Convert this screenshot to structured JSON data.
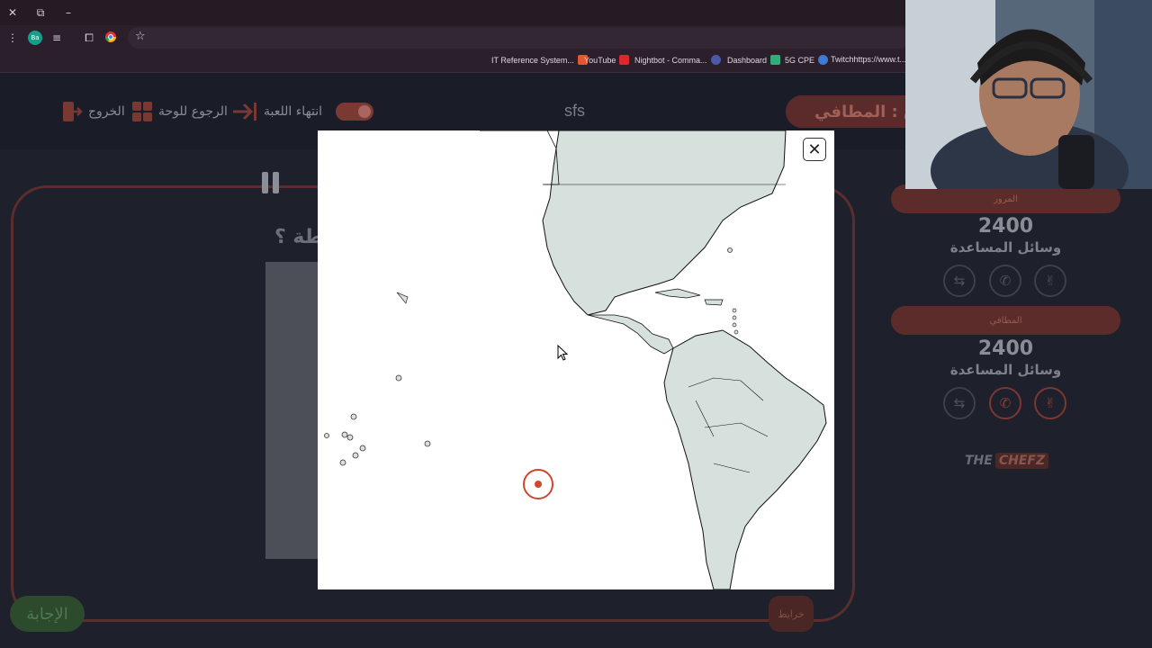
{
  "browser": {
    "bookmarks": [
      {
        "label": "IT Reference System...",
        "color": "#e4572e"
      },
      {
        "label": "YouTube",
        "color": "#e0262d"
      },
      {
        "label": "Nightbot - Comma...",
        "color": "#4a5aa8"
      },
      {
        "label": "Dashboard",
        "color": "#2fae7a"
      },
      {
        "label": "5G CPE",
        "color": "#3b7bd6"
      },
      {
        "label": "Twitchhttps://www.t...",
        "color": "#9146ff"
      }
    ],
    "profile_badge": "Ba"
  },
  "nav": {
    "exit_label": "الخروج",
    "back_label": "الرجوع للوحة",
    "end_game_label": "انتهاء اللعبة",
    "brand": "sfs",
    "team_label": "ق : المطافي"
  },
  "board": {
    "question": "طة ؟",
    "answer_label": "الإجابة",
    "map_label": "خرايط"
  },
  "teams": [
    {
      "name": "المرور",
      "score": "2400",
      "helpers_title": "وسائل المساعدة"
    },
    {
      "name": "المطافي",
      "score": "2400",
      "helpers_title": "وسائل المساعدة"
    }
  ],
  "logo": {
    "part1": "THE",
    "part2": "CHEFZ"
  },
  "modal": {
    "close_icon": "close-icon",
    "map_fill": "#d6e0dc",
    "marker_color": "#d2452f"
  },
  "colors": {
    "accent": "#5c2c2a",
    "answer_green": "#2c4a2c"
  }
}
